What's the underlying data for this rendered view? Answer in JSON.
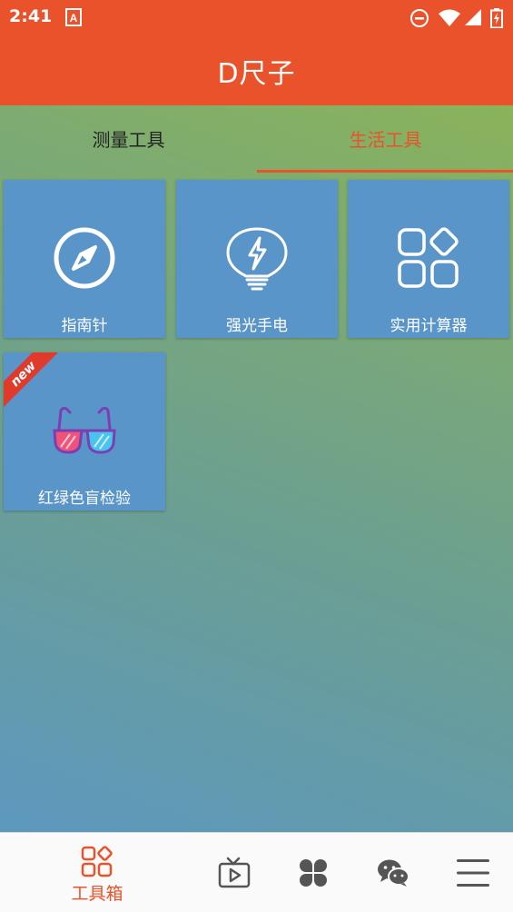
{
  "status_bar": {
    "time": "2:41"
  },
  "app_bar": {
    "title": "D尺子"
  },
  "tabs": [
    {
      "label": "测量工具",
      "active": false
    },
    {
      "label": "生活工具",
      "active": true
    }
  ],
  "tools": [
    {
      "label": "指南针",
      "icon": "compass-icon"
    },
    {
      "label": "强光手电",
      "icon": "flashlight-bulb-icon"
    },
    {
      "label": "实用计算器",
      "icon": "apps-grid-icon"
    },
    {
      "label": "红绿色盲检验",
      "icon": "3d-glasses-icon",
      "badge": "new"
    }
  ],
  "bottom_nav": [
    {
      "label": "工具箱",
      "icon": "toolbox-grid-icon",
      "active": true
    },
    {
      "label": "",
      "icon": "tv-play-icon"
    },
    {
      "label": "",
      "icon": "clover-icon"
    },
    {
      "label": "",
      "icon": "wechat-icon"
    },
    {
      "label": "",
      "icon": "menu-icon"
    }
  ],
  "colors": {
    "primary": "#e9522b",
    "tile": "#5a95c9",
    "nav_icon": "#555555"
  }
}
